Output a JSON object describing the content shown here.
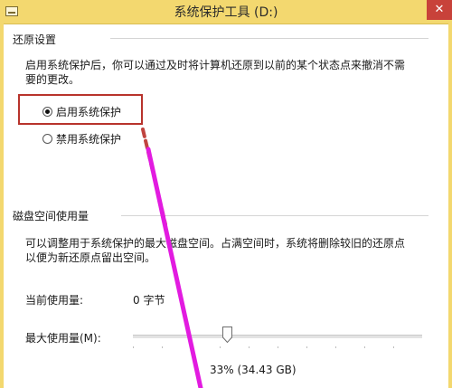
{
  "window": {
    "title": "系统保护工具 (D:)",
    "close_glyph": "✕"
  },
  "restore": {
    "header": "还原设置",
    "description_line1": "启用系统保护后，你可以通过及时将计算机还原到以前的某个状态点来撤消不需",
    "description_line2": "要的更改。",
    "options": [
      {
        "label": "启用系统保护",
        "checked": true
      },
      {
        "label": "禁用系统保护",
        "checked": false
      }
    ]
  },
  "disk": {
    "header": "磁盘空间使用量",
    "description_line1": "可以调整用于系统保护的最大磁盘空间。占满空间时，系统将删除较旧的还原点",
    "description_line2": "以便为新还原点留出空间。",
    "current_label": "当前使用量:",
    "current_value": "0 字节",
    "max_label": "最大使用量(M):",
    "max_percent_text": "33% (34.43 GB)",
    "max_fraction": 0.33
  },
  "colors": {
    "titlebar": "#f3d86f",
    "highlight": "#b8332c",
    "annotation_red": "#c0443f",
    "annotation_magenta": "#e21be0"
  },
  "icons": {
    "window_icon": "system-menu-icon",
    "close": "close-icon"
  }
}
